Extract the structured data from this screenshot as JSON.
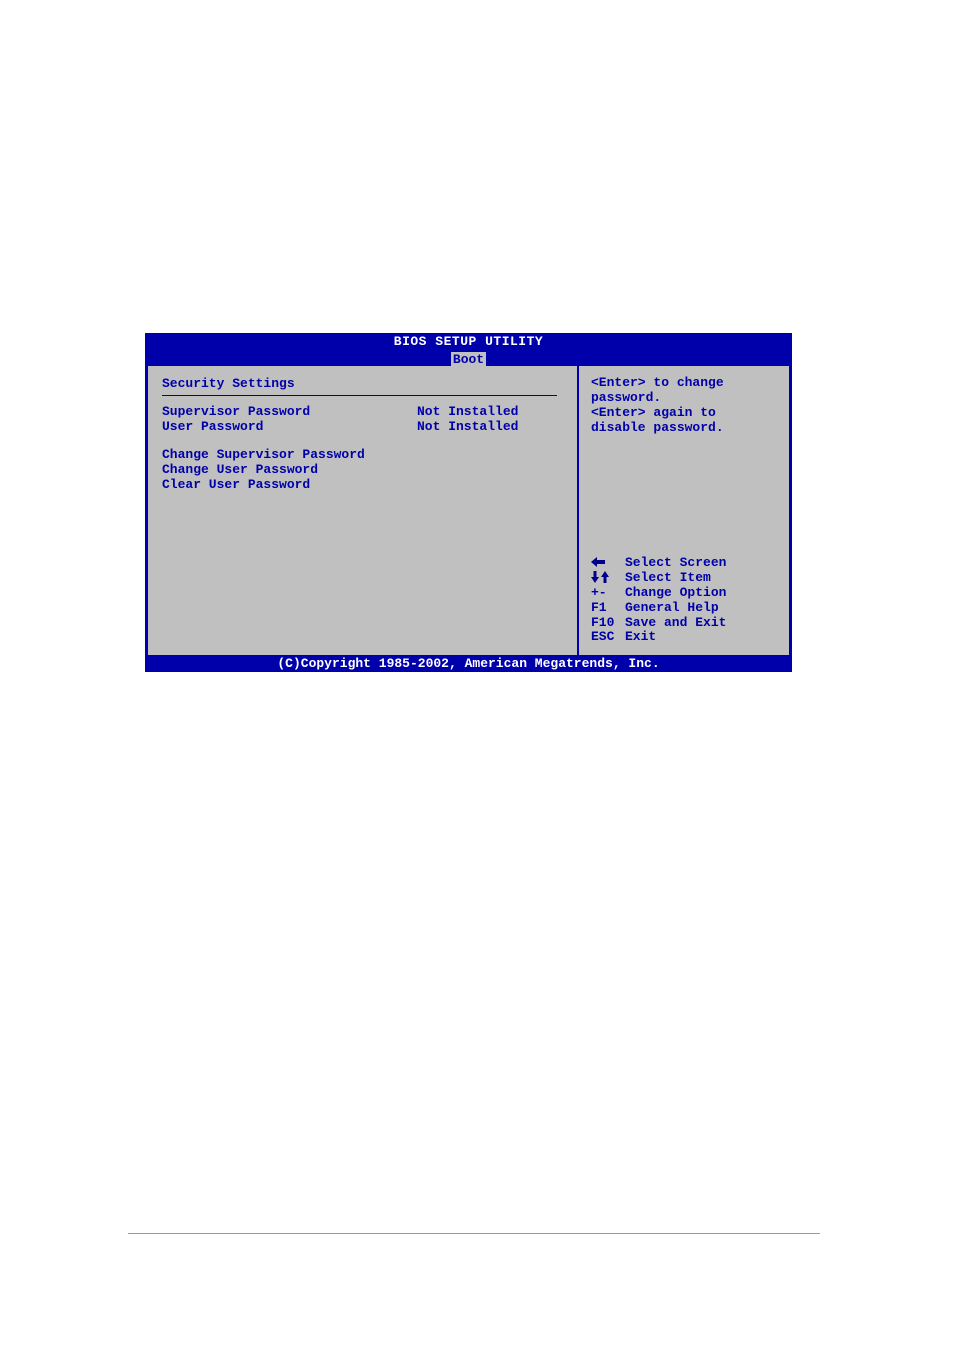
{
  "title": "BIOS SETUP UTILITY",
  "active_tab": "Boot",
  "section_title": "Security Settings",
  "settings": [
    {
      "label": "Supervisor Password",
      "value": "Not Installed"
    },
    {
      "label": "User Password",
      "value": "Not Installed"
    }
  ],
  "actions": [
    "Change Supervisor Password",
    "Change User Password",
    "Clear User Password"
  ],
  "help_lines": [
    "<Enter> to change",
    "password.",
    "<Enter> again to",
    "disable password."
  ],
  "key_help": [
    {
      "key": "left-arrow",
      "label": "Select Screen"
    },
    {
      "key": "updown-arrow",
      "label": "Select Item"
    },
    {
      "key": "+-",
      "label": "Change Option"
    },
    {
      "key": "F1",
      "label": "General Help"
    },
    {
      "key": "F10",
      "label": "Save and Exit"
    },
    {
      "key": "ESC",
      "label": "Exit"
    }
  ],
  "footer": "(C)Copyright 1985-2002, American Megatrends, Inc."
}
